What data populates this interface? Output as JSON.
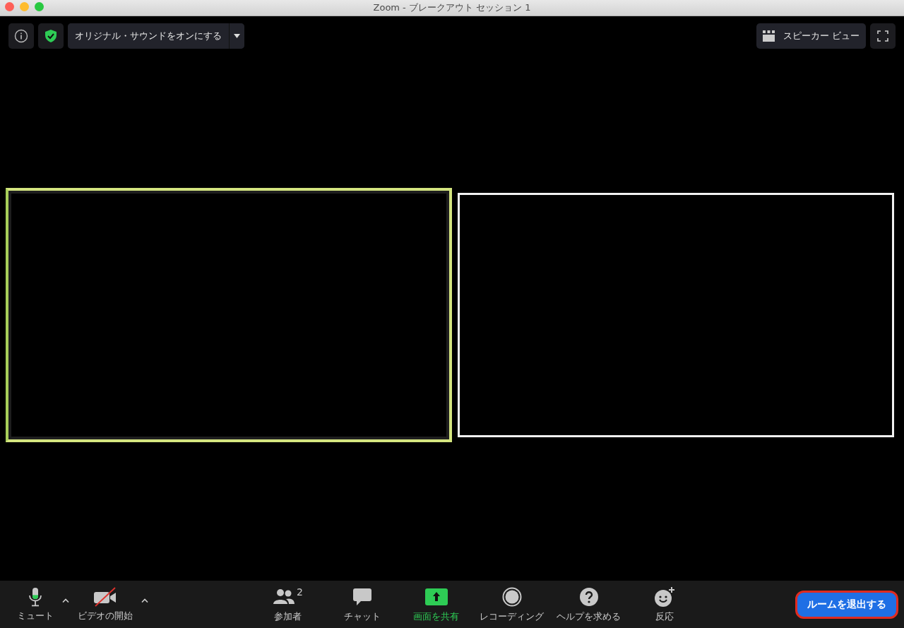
{
  "window": {
    "title": "Zoom - ブレークアウト セッション 1"
  },
  "top_bar": {
    "original_sound": {
      "label": "オリジナル・サウンドをオンにする"
    },
    "view_button": {
      "label": "スピーカー ビュー"
    }
  },
  "tiles": [
    {
      "active": true
    },
    {
      "active": false
    }
  ],
  "toolbar": [
    {
      "kind": "mic",
      "label": "ミュート",
      "level": 0.35,
      "has_menu": true
    },
    {
      "kind": "video",
      "label": "ビデオの開始",
      "off": true,
      "has_menu": true
    },
    {
      "kind": "participants",
      "label": "参加者",
      "count": "2"
    },
    {
      "kind": "chat",
      "label": "チャット"
    },
    {
      "kind": "share",
      "label": "画面を共有",
      "highlighted": true
    },
    {
      "kind": "record",
      "label": "レコーディング"
    },
    {
      "kind": "help",
      "label": "ヘルプを求める"
    },
    {
      "kind": "reactions",
      "label": "反応"
    }
  ],
  "leave_button": {
    "label": "ルームを退出する"
  }
}
